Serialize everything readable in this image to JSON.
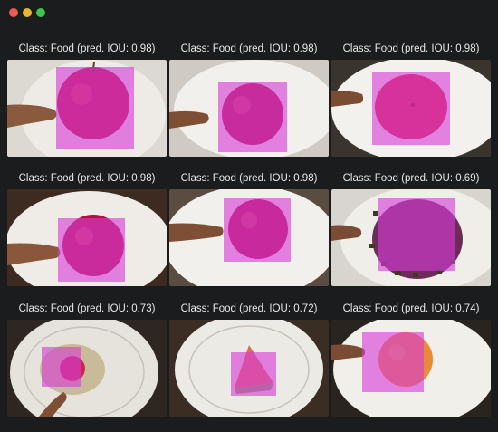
{
  "window": {
    "controls": [
      "close",
      "minimize",
      "maximize"
    ],
    "colors": {
      "close": "#ee5b55",
      "minimize": "#e6b531",
      "maximize": "#3fc44c"
    }
  },
  "bbox_color": "#d63cd6",
  "results": [
    {
      "caption": "Class: Food (pred. IOU: 0.98)",
      "object": "red apple, hand"
    },
    {
      "caption": "Class: Food (pred. IOU: 0.98)",
      "object": "red apple on plate, hand"
    },
    {
      "caption": "Class: Food (pred. IOU: 0.98)",
      "object": "red tomato, hand"
    },
    {
      "caption": "Class: Food (pred. IOU: 0.98)",
      "object": "red apple, hand"
    },
    {
      "caption": "Class: Food (pred. IOU: 0.98)",
      "object": "red apple on plate, hand"
    },
    {
      "caption": "Class: Food (pred. IOU: 0.69)",
      "object": "chopped vegetables on plate"
    },
    {
      "caption": "Class: Food (pred. IOU: 0.73)",
      "object": "small fruit on plate, finger"
    },
    {
      "caption": "Class: Food (pred. IOU: 0.72)",
      "object": "watermelon slice on plate"
    },
    {
      "caption": "Class: Food (pred. IOU: 0.74)",
      "object": "orange fruit on plate, hand"
    }
  ]
}
